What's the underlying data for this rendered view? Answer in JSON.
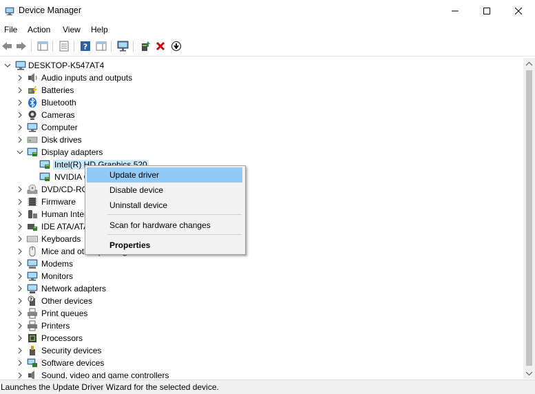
{
  "window": {
    "title": "Device Manager"
  },
  "menu": [
    "File",
    "Action",
    "View",
    "Help"
  ],
  "toolbar_icons": [
    "back-icon",
    "forward-icon",
    "show-hide-tree-icon",
    "properties-icon",
    "help-icon",
    "details-pane-icon",
    "monitor-icon",
    "update-driver-icon",
    "uninstall-icon",
    "scan-down-icon"
  ],
  "tree": {
    "root": "DESKTOP-K547AT4",
    "items": [
      {
        "label": "Audio inputs and outputs",
        "icon": "speaker-icon"
      },
      {
        "label": "Batteries",
        "icon": "battery-icon"
      },
      {
        "label": "Bluetooth",
        "icon": "bluetooth-icon"
      },
      {
        "label": "Cameras",
        "icon": "camera-icon"
      },
      {
        "label": "Computer",
        "icon": "computer-icon"
      },
      {
        "label": "Disk drives",
        "icon": "disk-drive-icon"
      },
      {
        "label": "Display adapters",
        "icon": "display-adapter-icon",
        "expanded": true
      },
      {
        "label": "Intel(R) HD Graphics 520",
        "icon": "display-adapter-icon",
        "child": true,
        "selected": true
      },
      {
        "label": "NVIDIA GeForce 940M",
        "icon": "display-adapter-icon",
        "child": true
      },
      {
        "label": "DVD/CD-ROM drives",
        "icon": "dvd-icon"
      },
      {
        "label": "Firmware",
        "icon": "firmware-icon"
      },
      {
        "label": "Human Interface Devices",
        "icon": "hid-icon"
      },
      {
        "label": "IDE ATA/ATAPI controllers",
        "icon": "ide-icon"
      },
      {
        "label": "Keyboards",
        "icon": "keyboard-icon"
      },
      {
        "label": "Mice and other pointing devices",
        "icon": "mouse-icon"
      },
      {
        "label": "Modems",
        "icon": "modem-icon"
      },
      {
        "label": "Monitors",
        "icon": "monitor-icon"
      },
      {
        "label": "Network adapters",
        "icon": "network-icon"
      },
      {
        "label": "Other devices",
        "icon": "other-devices-icon"
      },
      {
        "label": "Print queues",
        "icon": "print-queue-icon"
      },
      {
        "label": "Printers",
        "icon": "printer-icon"
      },
      {
        "label": "Processors",
        "icon": "processor-icon"
      },
      {
        "label": "Security devices",
        "icon": "security-icon"
      },
      {
        "label": "Software devices",
        "icon": "software-device-icon"
      },
      {
        "label": "Sound, video and game controllers",
        "icon": "sound-icon"
      }
    ]
  },
  "context_menu": {
    "items": [
      "Update driver",
      "Disable device",
      "Uninstall device",
      "Scan for hardware changes",
      "Properties"
    ]
  },
  "status": "Launches the Update Driver Wizard for the selected device.",
  "colors": {
    "selection": "#cce8ff",
    "menu_highlight": "#91c9f7",
    "close_x": "#d40000"
  }
}
